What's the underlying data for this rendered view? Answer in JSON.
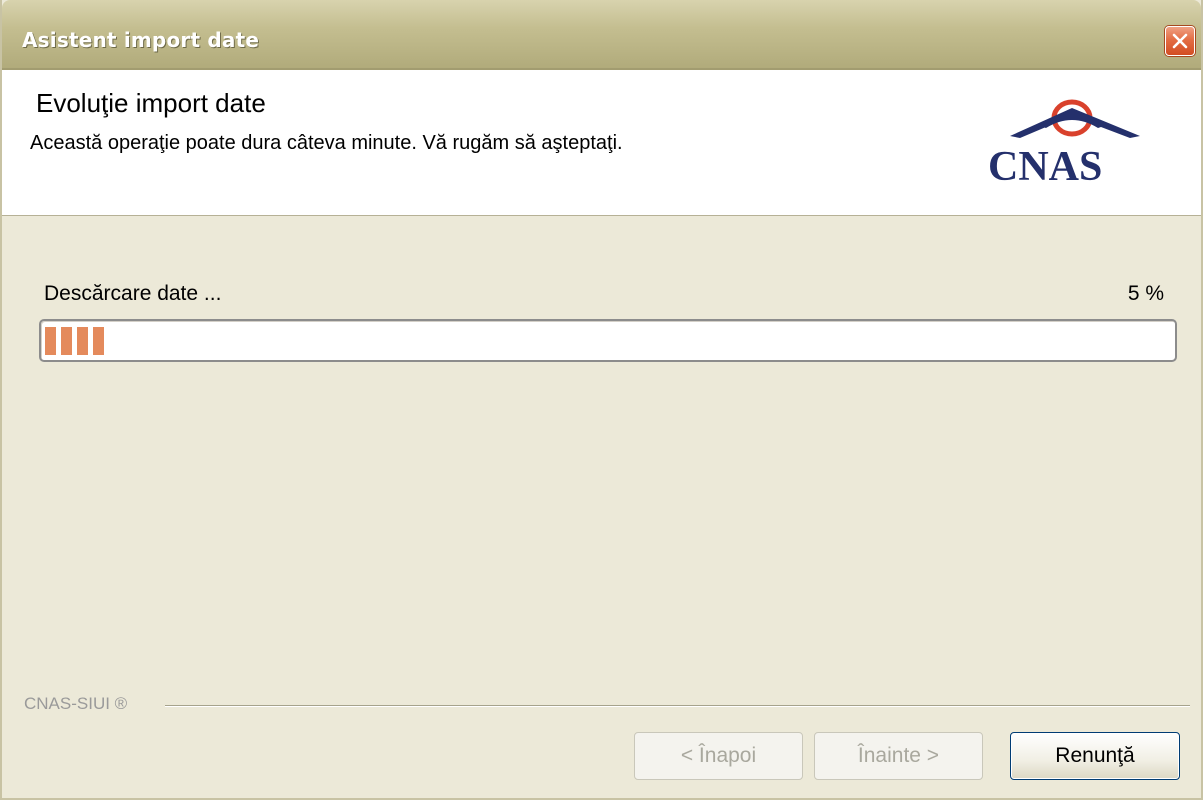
{
  "window": {
    "title": "Asistent import date"
  },
  "header": {
    "title": "Evoluţie import date",
    "subtitle": "Această operaţie poate dura câteva minute. Vă rugăm să aşteptaţi.",
    "logo_text": "CNAS"
  },
  "progress": {
    "label": "Descărcare date ...",
    "percent_text": "5 %",
    "value": 0.05
  },
  "footer": {
    "brand": "CNAS-SIUI ®"
  },
  "buttons": {
    "back_label": "< Înapoi",
    "next_label": "Înainte >",
    "cancel_label": "Renunţă"
  },
  "icons": {
    "close": "close-icon"
  },
  "colors": {
    "progress_segment": "#e48a5c",
    "logo_blue": "#24306c",
    "logo_red": "#d9412c"
  }
}
